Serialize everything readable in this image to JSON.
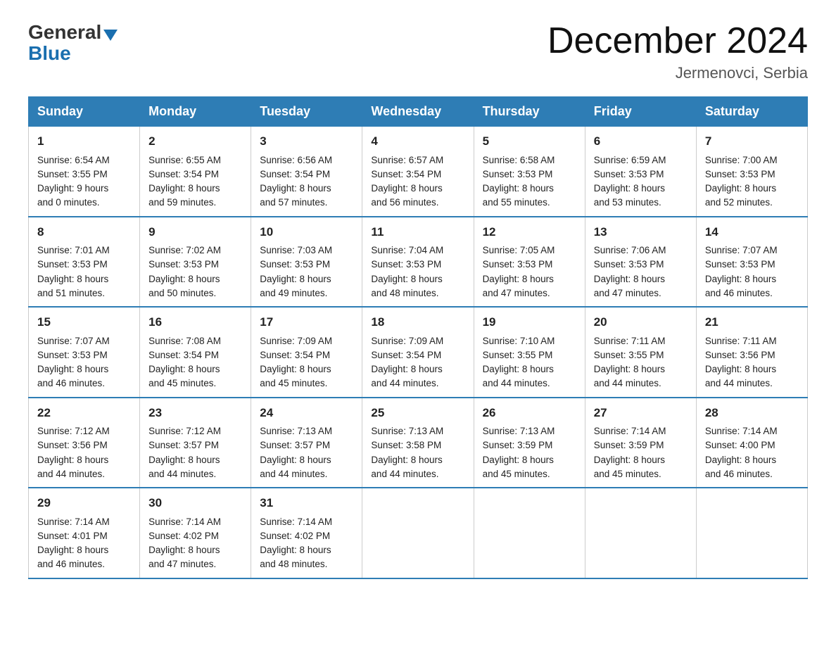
{
  "header": {
    "logo_general": "General",
    "logo_blue": "Blue",
    "title": "December 2024",
    "subtitle": "Jermenovci, Serbia"
  },
  "calendar": {
    "headers": [
      "Sunday",
      "Monday",
      "Tuesday",
      "Wednesday",
      "Thursday",
      "Friday",
      "Saturday"
    ],
    "weeks": [
      [
        {
          "day": "1",
          "sunrise": "6:54 AM",
          "sunset": "3:55 PM",
          "daylight": "9 hours and 0 minutes."
        },
        {
          "day": "2",
          "sunrise": "6:55 AM",
          "sunset": "3:54 PM",
          "daylight": "8 hours and 59 minutes."
        },
        {
          "day": "3",
          "sunrise": "6:56 AM",
          "sunset": "3:54 PM",
          "daylight": "8 hours and 57 minutes."
        },
        {
          "day": "4",
          "sunrise": "6:57 AM",
          "sunset": "3:54 PM",
          "daylight": "8 hours and 56 minutes."
        },
        {
          "day": "5",
          "sunrise": "6:58 AM",
          "sunset": "3:53 PM",
          "daylight": "8 hours and 55 minutes."
        },
        {
          "day": "6",
          "sunrise": "6:59 AM",
          "sunset": "3:53 PM",
          "daylight": "8 hours and 53 minutes."
        },
        {
          "day": "7",
          "sunrise": "7:00 AM",
          "sunset": "3:53 PM",
          "daylight": "8 hours and 52 minutes."
        }
      ],
      [
        {
          "day": "8",
          "sunrise": "7:01 AM",
          "sunset": "3:53 PM",
          "daylight": "8 hours and 51 minutes."
        },
        {
          "day": "9",
          "sunrise": "7:02 AM",
          "sunset": "3:53 PM",
          "daylight": "8 hours and 50 minutes."
        },
        {
          "day": "10",
          "sunrise": "7:03 AM",
          "sunset": "3:53 PM",
          "daylight": "8 hours and 49 minutes."
        },
        {
          "day": "11",
          "sunrise": "7:04 AM",
          "sunset": "3:53 PM",
          "daylight": "8 hours and 48 minutes."
        },
        {
          "day": "12",
          "sunrise": "7:05 AM",
          "sunset": "3:53 PM",
          "daylight": "8 hours and 47 minutes."
        },
        {
          "day": "13",
          "sunrise": "7:06 AM",
          "sunset": "3:53 PM",
          "daylight": "8 hours and 47 minutes."
        },
        {
          "day": "14",
          "sunrise": "7:07 AM",
          "sunset": "3:53 PM",
          "daylight": "8 hours and 46 minutes."
        }
      ],
      [
        {
          "day": "15",
          "sunrise": "7:07 AM",
          "sunset": "3:53 PM",
          "daylight": "8 hours and 46 minutes."
        },
        {
          "day": "16",
          "sunrise": "7:08 AM",
          "sunset": "3:54 PM",
          "daylight": "8 hours and 45 minutes."
        },
        {
          "day": "17",
          "sunrise": "7:09 AM",
          "sunset": "3:54 PM",
          "daylight": "8 hours and 45 minutes."
        },
        {
          "day": "18",
          "sunrise": "7:09 AM",
          "sunset": "3:54 PM",
          "daylight": "8 hours and 44 minutes."
        },
        {
          "day": "19",
          "sunrise": "7:10 AM",
          "sunset": "3:55 PM",
          "daylight": "8 hours and 44 minutes."
        },
        {
          "day": "20",
          "sunrise": "7:11 AM",
          "sunset": "3:55 PM",
          "daylight": "8 hours and 44 minutes."
        },
        {
          "day": "21",
          "sunrise": "7:11 AM",
          "sunset": "3:56 PM",
          "daylight": "8 hours and 44 minutes."
        }
      ],
      [
        {
          "day": "22",
          "sunrise": "7:12 AM",
          "sunset": "3:56 PM",
          "daylight": "8 hours and 44 minutes."
        },
        {
          "day": "23",
          "sunrise": "7:12 AM",
          "sunset": "3:57 PM",
          "daylight": "8 hours and 44 minutes."
        },
        {
          "day": "24",
          "sunrise": "7:13 AM",
          "sunset": "3:57 PM",
          "daylight": "8 hours and 44 minutes."
        },
        {
          "day": "25",
          "sunrise": "7:13 AM",
          "sunset": "3:58 PM",
          "daylight": "8 hours and 44 minutes."
        },
        {
          "day": "26",
          "sunrise": "7:13 AM",
          "sunset": "3:59 PM",
          "daylight": "8 hours and 45 minutes."
        },
        {
          "day": "27",
          "sunrise": "7:14 AM",
          "sunset": "3:59 PM",
          "daylight": "8 hours and 45 minutes."
        },
        {
          "day": "28",
          "sunrise": "7:14 AM",
          "sunset": "4:00 PM",
          "daylight": "8 hours and 46 minutes."
        }
      ],
      [
        {
          "day": "29",
          "sunrise": "7:14 AM",
          "sunset": "4:01 PM",
          "daylight": "8 hours and 46 minutes."
        },
        {
          "day": "30",
          "sunrise": "7:14 AM",
          "sunset": "4:02 PM",
          "daylight": "8 hours and 47 minutes."
        },
        {
          "day": "31",
          "sunrise": "7:14 AM",
          "sunset": "4:02 PM",
          "daylight": "8 hours and 48 minutes."
        },
        null,
        null,
        null,
        null
      ]
    ],
    "sunrise_label": "Sunrise:",
    "sunset_label": "Sunset:",
    "daylight_label": "Daylight:"
  }
}
